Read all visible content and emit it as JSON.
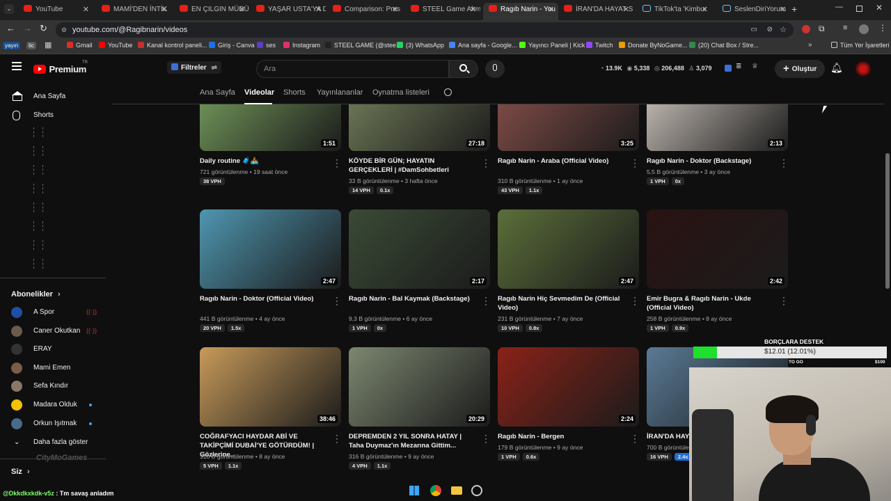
{
  "browser": {
    "tabs": [
      {
        "title": "YouTube",
        "fav": "yt"
      },
      {
        "title": "MAMİ'DEN İNTİK",
        "fav": "yt"
      },
      {
        "title": "EN ÇILGIN MÜDÜ",
        "fav": "yt"
      },
      {
        "title": "YAŞAR USTA'YA D",
        "fav": "yt"
      },
      {
        "title": "Comparison: Pres",
        "fav": "yt"
      },
      {
        "title": "STEEL Game Ahm",
        "fav": "yt"
      },
      {
        "title": "Ragıb Narin - You",
        "fav": "yt"
      },
      {
        "title": "İRAN'DA HAYAT S",
        "fav": "yt"
      },
      {
        "title": "TikTok'ta 'Kimbur",
        "fav": "tk"
      },
      {
        "title": "SeslenDiriYorum",
        "fav": "tk"
      }
    ],
    "url": "youtube.com/@Ragibnarin/videos",
    "bookmarks": [
      "Gmail",
      "YouTube",
      "Kanal kontrol paneli...",
      "Giriş - Canva",
      "ses",
      "Instagram",
      "STEEL GAME (@stee...",
      "(3) WhatsApp",
      "Ana sayfa - Google...",
      "Yayıncı Paneli | Kick",
      "Twitch",
      "Donate ByNoGame...",
      "(20) Chat Box / Stre..."
    ],
    "bookmark_pills": [
      "yayın",
      "tic"
    ],
    "all_bookmarks": "Tüm Yer İşaretleri"
  },
  "masthead": {
    "logo": "Premium",
    "logo_region": "TR",
    "filters": "Filtreler",
    "search_placeholder": "Ara",
    "stats": [
      "13.9K",
      "5,338",
      "206,488",
      "3,079"
    ],
    "create": "Oluştur"
  },
  "sidebar": {
    "home": "Ana Sayfa",
    "shorts": "Shorts",
    "subscriptions_header": "Abonelikler",
    "subscriptions": [
      {
        "name": "A Spor",
        "live": true,
        "color": "#1e4fa6"
      },
      {
        "name": "Caner Okutkan",
        "live": true,
        "color": "#6b5b4b"
      },
      {
        "name": "ERAY",
        "live": false,
        "color": "#333"
      },
      {
        "name": "Mami Emen",
        "live": false,
        "color": "#7a5c4a"
      },
      {
        "name": "Sefa Kındır",
        "live": false,
        "color": "#8a7866"
      },
      {
        "name": "Madara Olduk",
        "live": false,
        "dot": true,
        "color": "#f3c300"
      },
      {
        "name": "Orkun Işıtmak",
        "live": false,
        "dot": true,
        "color": "#4a6a8a"
      }
    ],
    "more": "Daha fazla göster",
    "you": "Siz"
  },
  "channel_tabs": [
    "Ana Sayfa",
    "Videolar",
    "Shorts",
    "Yayınlananlar",
    "Oynatma listeleri"
  ],
  "videos": [
    {
      "title": "Daily routine 🧳🚣",
      "meta": "721 görüntülenme • 19 saat önce",
      "vph": "38 VPH",
      "x": "",
      "dur": "1:51",
      "thumb": "#6c8f55"
    },
    {
      "title": "KÖYDE BİR GÜN; HAYATIN GERÇEKLERİ | #DamSohbetleri",
      "meta": "33 B görüntülenme • 3 hafta önce",
      "vph": "14 VPH",
      "x": "0.1x",
      "dur": "27:18",
      "thumb": "#6a7454"
    },
    {
      "title": "Ragıb Narin - Araba (Official Video)",
      "meta": "310 B görüntülenme • 1 ay önce",
      "vph": "43 VPH",
      "x": "1.1x",
      "dur": "3:25",
      "thumb": "#7c4a45"
    },
    {
      "title": "Ragıb Narin - Doktor (Backstage)",
      "meta": "5,5 B görüntülenme • 3 ay önce",
      "vph": "1 VPH",
      "x": "0x",
      "dur": "2:13",
      "thumb": "#b9b2ab"
    },
    {
      "title": "Ragıb Narin - Doktor (Official Video)",
      "meta": "441 B görüntülenme • 4 ay önce",
      "vph": "20 VPH",
      "x": "1.5x",
      "dur": "2:47",
      "thumb": "#4f96b0"
    },
    {
      "title": "Ragıb Narin - Bal Kaymak (Backstage)",
      "meta": "9,3 B görüntülenme • 6 ay önce",
      "vph": "1 VPH",
      "x": "0x",
      "dur": "2:17",
      "thumb": "#3a4a36"
    },
    {
      "title": "Ragıb Narin Hiç Sevmedim De (Official Video)",
      "meta": "231 B görüntülenme • 7 ay önce",
      "vph": "10 VPH",
      "x": "0.8x",
      "dur": "2:47",
      "thumb": "#5c6f3a"
    },
    {
      "title": "Emir Bugra & Ragıb Narin - Ukde (Official Video)",
      "meta": "258 B görüntülenme • 8 ay önce",
      "vph": "1 VPH",
      "x": "0.9x",
      "dur": "2:42",
      "thumb": "#2a1212"
    },
    {
      "title": "COĞRAFYACI HAYDAR ABİ VE TAKİPÇİMİ DUBAİ'YE GÖTÜRDÜM! | Gözlerine...",
      "meta": "310 B görüntülenme • 8 ay önce",
      "vph": "5 VPH",
      "x": "1.1x",
      "dur": "38:46",
      "thumb": "#c79a5a"
    },
    {
      "title": "DEPREMDEN 2 YIL SONRA HATAY | Taha Duymaz'ın Mezarına Gittim...",
      "meta": "316 B görüntülenme • 9 ay önce",
      "vph": "4 VPH",
      "x": "1.1x",
      "dur": "20:29",
      "thumb": "#7c8770"
    },
    {
      "title": "Ragıb Narin - Bergen",
      "meta": "179 B görüntülenme • 9 ay önce",
      "vph": "1 VPH",
      "x": "0.6x",
      "dur": "2:24",
      "thumb": "#8a2218"
    },
    {
      "title": "İRAN'DA HAYA... Tahran Sokakl...",
      "meta": "700 B görüntülenme",
      "vph": "16 VPH",
      "x": "2.4x",
      "dur": "",
      "thumb": "#5a7a96"
    }
  ],
  "donation": {
    "title": "BORÇLARA DESTEK",
    "amount": "$12.01 (12.01%)",
    "progress": 0.1201,
    "to_go": "TO GO",
    "goal": "$100"
  },
  "chat": {
    "user": "@Dkkdkxkdk-v5z",
    "message": " : Tm savaş anladım"
  },
  "overlay_logo": "CityMoGames"
}
